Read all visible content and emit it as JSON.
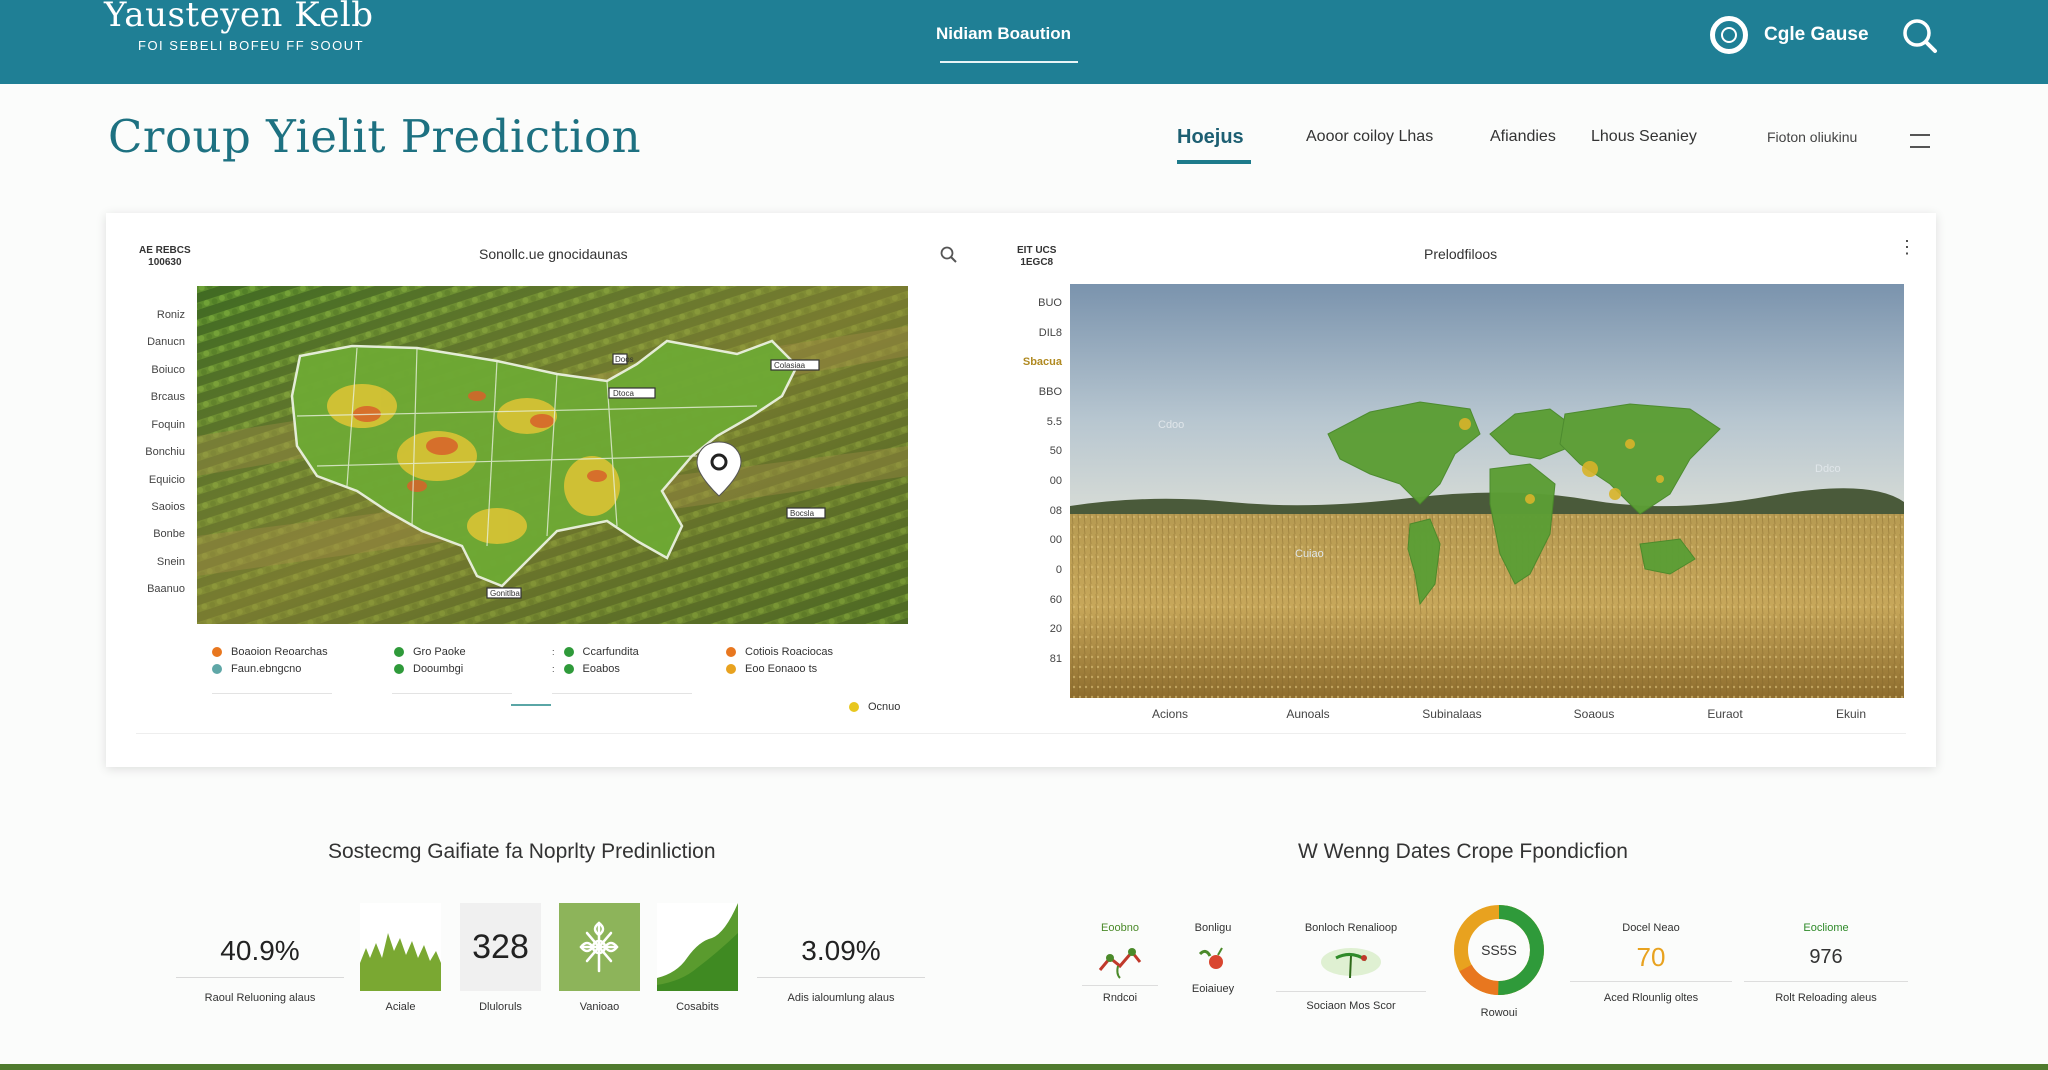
{
  "header": {
    "brand": "Yausteyen Kelb",
    "tagline": "FOI SEBELI BOFEU FF SOOUT",
    "center_nav": "Nidiam Boaution",
    "account_name": "Cgle Gause"
  },
  "page": {
    "title": "Croup Yielit Prediction",
    "nav": [
      "Hoejus",
      "Aooor coiloy Lhas",
      "Afiandies",
      "Lhous Seaniey"
    ],
    "nav_secondary": "Fioton oliukinu"
  },
  "left_panel": {
    "corner": [
      "AE REBCS",
      "100630"
    ],
    "title": "Sonollc.ue gnocidaunas",
    "y_labels": [
      "Roniz",
      "Danucn",
      "Boiuco",
      "Brcaus",
      "Foquin",
      "Bonchiu",
      "Equicio",
      "Saoios",
      "Bonbe",
      "Snein",
      "Baanuo"
    ],
    "map_markers": [
      "Dtoca",
      "Colasiaa",
      "Bocsla",
      "Gonitlba",
      "Doos"
    ],
    "legend": [
      {
        "label": "Boaoion Reoarchas",
        "color": "#e8771f"
      },
      {
        "label": "Faun.ebngcno",
        "color": "#5fa7a7"
      },
      {
        "label": "Gro Paoke",
        "color": "#2f9a3a"
      },
      {
        "label": "Dooumbgi",
        "color": "#2f9a3a"
      },
      {
        "label": "Ccarfundita",
        "color": "#2f9a3a"
      },
      {
        "label": "Eoabos",
        "color": "#2f9a3a"
      },
      {
        "label": "Cotiois Roaciocas",
        "color": "#e8771f"
      },
      {
        "label": "Eoo Eonaoo ts",
        "color": "#e8a21f"
      }
    ],
    "legend_extra": {
      "label": "Ocnuo",
      "color": "#e8c71f"
    }
  },
  "right_panel": {
    "corner": [
      "EIT UCS",
      "1EGC8"
    ],
    "title": "Prelodfiloos",
    "y_labels": [
      "BUO",
      "DIL8",
      "Sbacua",
      "BBO",
      "5.5",
      "50",
      "00",
      "08",
      "00",
      "0",
      "60",
      "20",
      "81"
    ],
    "highlight_label_index": 2,
    "map_labels": [
      "Cdoo",
      "Ddco",
      "Cuiao"
    ],
    "x_labels": [
      "Acions",
      "Aunoals",
      "Subinalaas",
      "Soaous",
      "Euraot",
      "Ekuin"
    ]
  },
  "bottom_left": {
    "title": "Sostecmg Gaifiate fa Noprlty Predinliction",
    "kpis": [
      {
        "value": "40.9%",
        "label": "Raoul Reluoning alaus"
      },
      {
        "value": "3.09%",
        "label": "Adis ialoumlung alaus"
      }
    ],
    "tiles": [
      {
        "value": "",
        "label": "Aciale"
      },
      {
        "value": "328",
        "label": "Dluloruls"
      },
      {
        "value": "",
        "label": "Vanioao"
      },
      {
        "value": "",
        "label": "Cosabits"
      }
    ]
  },
  "bottom_right": {
    "title": "W Wenng Dates Crope Fpondicfion",
    "items": [
      {
        "top": "Eoobno",
        "bottom": "Rndcoi"
      },
      {
        "top": "Bonligu",
        "bottom": "Eoiaiuey"
      },
      {
        "top": "Bonloch Renalioop",
        "bottom": "Sociaon Mos Scor"
      },
      {
        "donut": "SS5S",
        "bottom": "Rowoui"
      },
      {
        "top": "Docel Neao",
        "value": "70",
        "bottom": "Aced Rlounlig oltes"
      },
      {
        "top": "Eocliome",
        "value": "976",
        "bottom": "Rolt Reloading aleus"
      }
    ]
  },
  "colors": {
    "topbar": "#1f7f95",
    "title": "#1d7181",
    "accent_green": "#7aa832",
    "accent_orange": "#e8a21f"
  }
}
